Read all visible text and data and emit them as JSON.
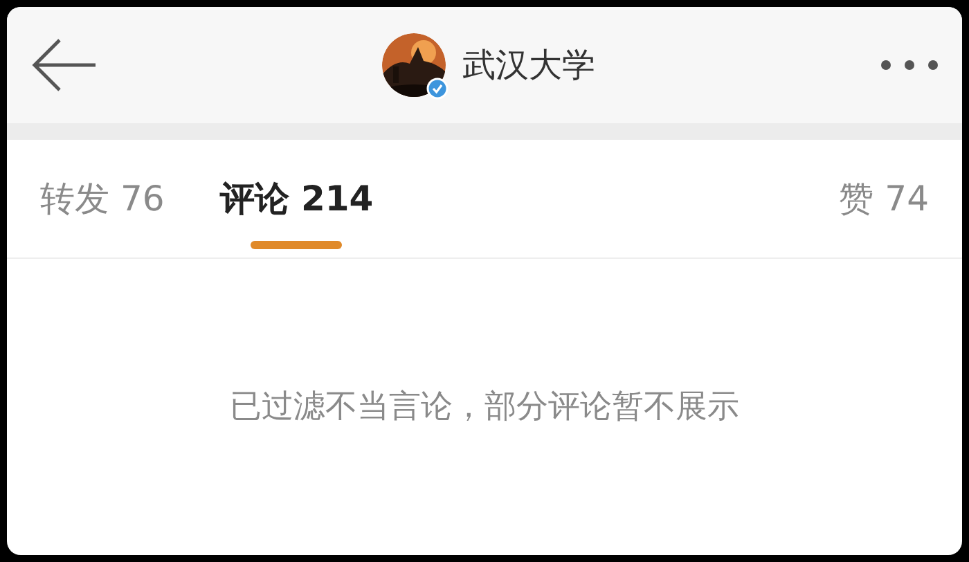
{
  "header": {
    "title": "武汉大学",
    "verified": true
  },
  "tabs": [
    {
      "label": "转发 76",
      "selected": false
    },
    {
      "label": "评论 214",
      "selected": true
    },
    {
      "label": "赞 74",
      "selected": false
    }
  ],
  "notice": "已过滤不当言论，部分评论暂不展示"
}
